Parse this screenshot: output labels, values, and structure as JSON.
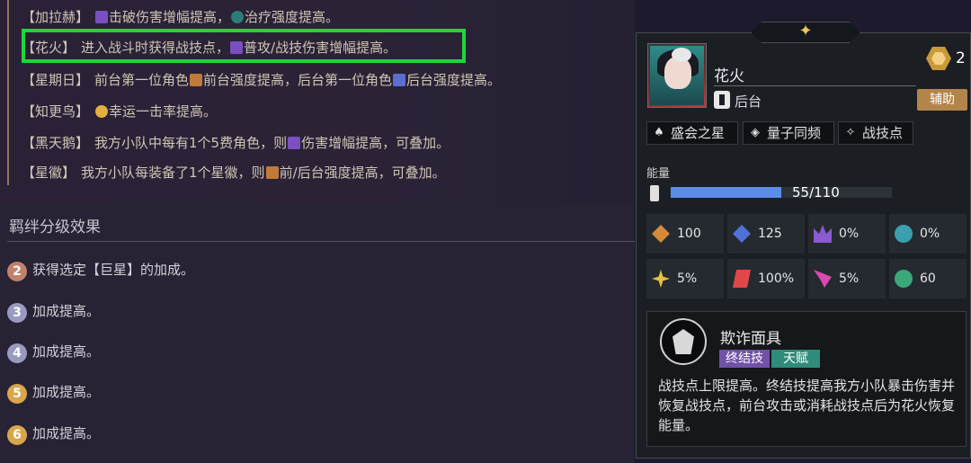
{
  "bonds": [
    {
      "name": "【加拉赫】",
      "icon1": "break-damage-icon",
      "text1": "击破伤害增幅提高，",
      "icon2": "healing-icon",
      "text2": "治疗强度提高。"
    },
    {
      "name": "【花火】",
      "text1": "进入战斗时获得战技点，",
      "icon1": "damage-boost-icon",
      "text2": "普攻/战技伤害增幅提高。"
    },
    {
      "name": "【星期日】",
      "text1": "前台第一位角色",
      "icon1": "front-strength-icon",
      "text2": "前台强度提高，后台第一位角色",
      "icon2": "back-strength-icon",
      "text3": "后台强度提高。"
    },
    {
      "name": "【知更鸟】",
      "icon1": "luck-icon",
      "text1": "幸运一击率提高。"
    },
    {
      "name": "【黑天鹅】",
      "text1": "我方小队中每有1个5费角色，则",
      "icon1": "damage-boost-icon",
      "text2": "伤害增幅提高，可叠加。"
    },
    {
      "name": "【星徽】",
      "text1": "我方小队每装备了1个星徽，则",
      "icon1": "front-back-strength-icon",
      "text2": "前/后台强度提高，可叠加。"
    }
  ],
  "tiers": {
    "title": "羁绊分级效果",
    "items": [
      {
        "num": "2",
        "text": "获得选定【巨星】的加成。",
        "color": "#c0826a"
      },
      {
        "num": "3",
        "text": "加成提高。",
        "color": "#9a9ac0"
      },
      {
        "num": "4",
        "text": "加成提高。",
        "color": "#9a9ac0"
      },
      {
        "num": "5",
        "text": "加成提高。",
        "color": "#d9a64a"
      },
      {
        "num": "6",
        "text": "加成提高。",
        "color": "#d9a64a"
      }
    ]
  },
  "character": {
    "name": "花火",
    "position": "后台",
    "cost": "2",
    "role": "辅助",
    "traits": [
      "盛会之星",
      "量子同频",
      "战技点"
    ],
    "energy_label": "能量",
    "energy_text": "55/110",
    "energy_fraction": 0.5,
    "stats": [
      "100",
      "125",
      "0%",
      "0%",
      "5%",
      "100%",
      "5%",
      "60"
    ]
  },
  "skill": {
    "name": "欺诈面具",
    "tag1": "终结技",
    "tag2": "天赋",
    "description": "战技点上限提高。终结技提高我方小队暴击伤害并恢复战技点，前台攻击或消耗战技点后为花火恢复能量。"
  },
  "colors": {
    "highlight": "#1ed63c",
    "energy": "#5b8de8",
    "support_tag": "#b3854a",
    "ult_tag": "#7152a8",
    "talent_tag": "#2f8c7a"
  }
}
